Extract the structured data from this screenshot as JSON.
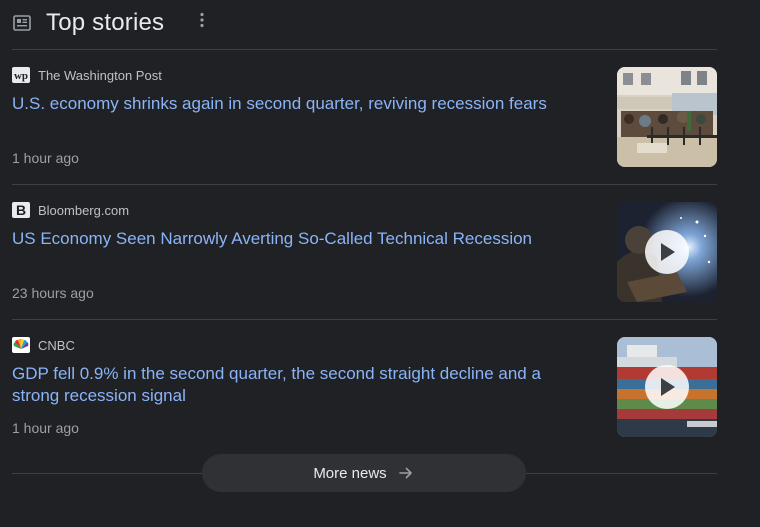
{
  "header": {
    "title": "Top stories",
    "icon": "newspaper-icon",
    "menu_icon": "more-vert-icon"
  },
  "stories": [
    {
      "source": "The Washington Post",
      "favicon": "washington-post-favicon",
      "headline": "U.S. economy shrinks again in second quarter, reviving recession fears",
      "time": "1 hour ago",
      "thumbnail": "restaurant-street-photo",
      "video": false
    },
    {
      "source": "Bloomberg.com",
      "favicon": "bloomberg-favicon",
      "headline": "US Economy Seen Narrowly Averting So-Called Technical Recession",
      "time": "23 hours ago",
      "thumbnail": "welder-sparks-photo",
      "video": true
    },
    {
      "source": "CNBC",
      "favicon": "cnbc-peacock-favicon",
      "headline": "GDP fell 0.9% in the second quarter, the second straight decline and a strong recession signal",
      "time": "1 hour ago",
      "thumbnail": "cargo-ship-photo",
      "video": true
    }
  ],
  "footer": {
    "more_news_label": "More news",
    "arrow_icon": "arrow-right-icon"
  },
  "colors": {
    "background": "#202124",
    "headline_link": "#8ab4f8",
    "title_text": "#e8eaed",
    "meta_text": "#9aa0a6",
    "divider": "#3c4043",
    "button_bg": "#303134"
  }
}
